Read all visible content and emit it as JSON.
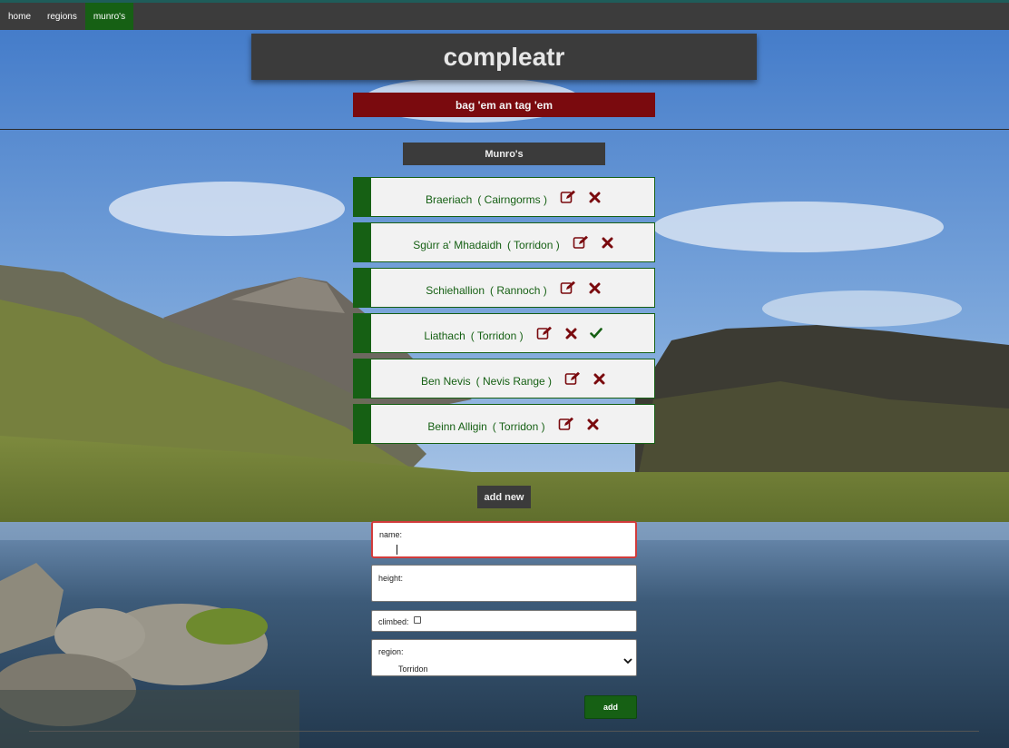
{
  "nav": {
    "items": [
      {
        "label": "home",
        "active": false
      },
      {
        "label": "regions",
        "active": false
      },
      {
        "label": "munro's",
        "active": true
      }
    ]
  },
  "header": {
    "title": "compleatr",
    "tagline": "bag 'em an tag 'em"
  },
  "munros": {
    "section_title": "Munro's",
    "items": [
      {
        "name": "Braeriach",
        "region": "( Cairngorms )",
        "climbed": false
      },
      {
        "name": "Sgùrr a' Mhadaidh",
        "region": "( Torridon )",
        "climbed": false
      },
      {
        "name": "Schiehallion",
        "region": "( Rannoch )",
        "climbed": false
      },
      {
        "name": "Liathach",
        "region": "( Torridon )",
        "climbed": true
      },
      {
        "name": "Ben Nevis",
        "region": "( Nevis Range )",
        "climbed": false
      },
      {
        "name": "Beinn Alligin",
        "region": "( Torridon )",
        "climbed": false
      }
    ],
    "icons": {
      "edit": "edit-icon",
      "delete": "delete-icon",
      "climbed": "check-icon"
    }
  },
  "form": {
    "title": "add new",
    "name_label": "name:",
    "name_value": "",
    "height_label": "height:",
    "height_value": "",
    "climbed_label": "climbed:",
    "region_label": "region:",
    "region_value": "Torridon",
    "submit_label": "add"
  },
  "colors": {
    "accent_green": "#166014",
    "accent_red": "#7a0a0e",
    "panel_dark": "#3b3b3b",
    "card_bg": "#f2f2f2"
  }
}
